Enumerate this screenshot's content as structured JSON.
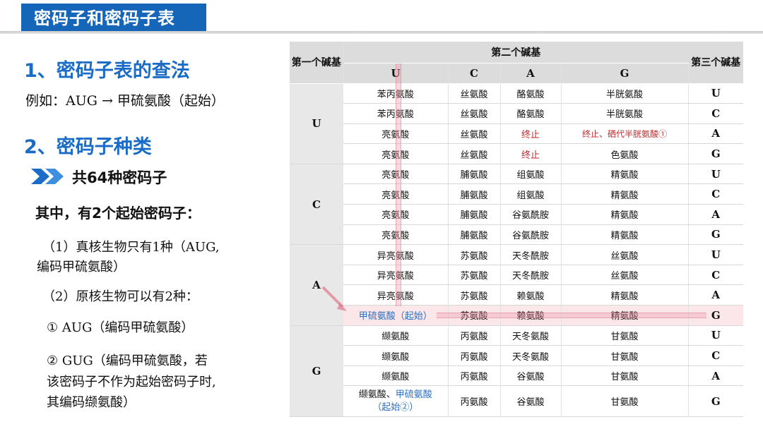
{
  "title": "密码子和密码子表",
  "section1": {
    "heading": "1、密码子表的查法",
    "example": "例如：AUG → 甲硫氨酸（起始）"
  },
  "section2": {
    "heading": "2、密码子种类",
    "total": "共64种密码子",
    "start_intro": "其中，有2个起始密码子：",
    "item1_line1": "（1）真核生物只有1种（AUG,",
    "item1_line2": "编码甲硫氨酸）",
    "item2": "（2）原核生物可以有2种：",
    "sub1": "① AUG（编码甲硫氨酸）",
    "sub2_line1": "② GUG（编码甲硫氨酸，若",
    "sub2_line2": "该密码子不作为起始密码子时,",
    "sub2_line3": "其编码缬氨酸）"
  },
  "table": {
    "header_first": "第一个碱基",
    "header_second": "第二个碱基",
    "header_third": "第三个碱基",
    "second_bases": [
      "U",
      "C",
      "A",
      "G"
    ],
    "groups": [
      {
        "first": "U",
        "rows": [
          {
            "u": "苯丙氨酸",
            "c": "丝氨酸",
            "a": "酪氨酸",
            "g": "半胱氨酸",
            "third": "U"
          },
          {
            "u": "苯丙氨酸",
            "c": "丝氨酸",
            "a": "酪氨酸",
            "g": "半胱氨酸",
            "third": "C"
          },
          {
            "u": "亮氨酸",
            "c": "丝氨酸",
            "a": "终止",
            "g": "终止、硒代半胱氨酸①",
            "third": "A"
          },
          {
            "u": "亮氨酸",
            "c": "丝氨酸",
            "a": "终止",
            "g": "色氨酸",
            "third": "G"
          }
        ]
      },
      {
        "first": "C",
        "rows": [
          {
            "u": "亮氨酸",
            "c": "脯氨酸",
            "a": "组氨酸",
            "g": "精氨酸",
            "third": "U"
          },
          {
            "u": "亮氨酸",
            "c": "脯氨酸",
            "a": "组氨酸",
            "g": "精氨酸",
            "third": "C"
          },
          {
            "u": "亮氨酸",
            "c": "脯氨酸",
            "a": "谷氨酰胺",
            "g": "精氨酸",
            "third": "A"
          },
          {
            "u": "亮氨酸",
            "c": "脯氨酸",
            "a": "谷氨酰胺",
            "g": "精氨酸",
            "third": "G"
          }
        ]
      },
      {
        "first": "A",
        "rows": [
          {
            "u": "异亮氨酸",
            "c": "苏氨酸",
            "a": "天冬酰胺",
            "g": "丝氨酸",
            "third": "U"
          },
          {
            "u": "异亮氨酸",
            "c": "苏氨酸",
            "a": "天冬酰胺",
            "g": "丝氨酸",
            "third": "C"
          },
          {
            "u": "异亮氨酸",
            "c": "苏氨酸",
            "a": "赖氨酸",
            "g": "精氨酸",
            "third": "A"
          },
          {
            "u": "甲硫氨酸（起始）",
            "c": "苏氨酸",
            "a": "赖氨酸",
            "g": "精氨酸",
            "third": "G"
          }
        ]
      },
      {
        "first": "G",
        "rows": [
          {
            "u": "缬氨酸",
            "c": "丙氨酸",
            "a": "天冬氨酸",
            "g": "甘氨酸",
            "third": "U"
          },
          {
            "u": "缬氨酸",
            "c": "丙氨酸",
            "a": "天冬氨酸",
            "g": "甘氨酸",
            "third": "C"
          },
          {
            "u": "缬氨酸",
            "c": "丙氨酸",
            "a": "谷氨酸",
            "g": "甘氨酸",
            "third": "A"
          },
          {
            "u_part1": "缬氨酸、",
            "u_part2": "甲硫氨酸",
            "u_part3": "（起始②）",
            "c": "丙氨酸",
            "a": "谷氨酸",
            "g": "甘氨酸",
            "third": "G"
          }
        ]
      }
    ]
  }
}
